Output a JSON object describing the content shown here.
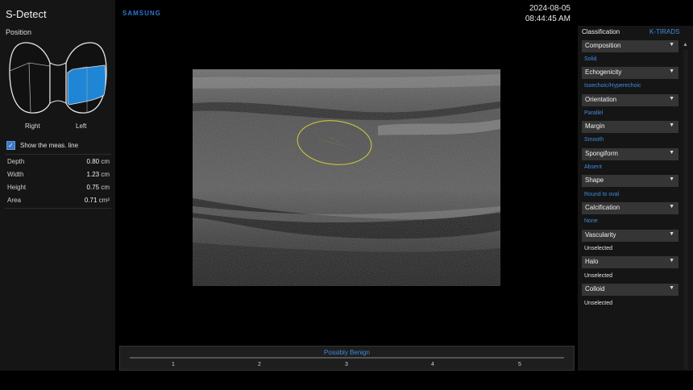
{
  "app": {
    "title": "S-Detect",
    "brand": "SAMSUNG"
  },
  "datetime": {
    "date": "2024-08-05",
    "time": "08:44:45 AM"
  },
  "position": {
    "label": "Position",
    "right": "Right",
    "left": "Left",
    "selected": "Left"
  },
  "measurement": {
    "show_line_label": "Show the meas. line",
    "show_line_checked": true,
    "rows": [
      {
        "label": "Depth",
        "value": "0.80",
        "unit": "cm"
      },
      {
        "label": "Width",
        "value": "1.23",
        "unit": "cm"
      },
      {
        "label": "Height",
        "value": "0.75",
        "unit": "cm"
      },
      {
        "label": "Area",
        "value": "0.71",
        "unit": "cm²"
      }
    ]
  },
  "classification": {
    "header": "Classification",
    "system": "K-TIRADS",
    "items": [
      {
        "name": "Composition",
        "value": "Solid",
        "state": "selected"
      },
      {
        "name": "Echogenicity",
        "value": "Isoechoic/Hyperechoic",
        "state": "selected"
      },
      {
        "name": "Orientation",
        "value": "Parallel",
        "state": "selected"
      },
      {
        "name": "Margin",
        "value": "Smooth",
        "state": "selected"
      },
      {
        "name": "Spongiform",
        "value": "Absent",
        "state": "selected"
      },
      {
        "name": "Shape",
        "value": "Round to oval",
        "state": "selected"
      },
      {
        "name": "Calcification",
        "value": "None",
        "state": "selected"
      },
      {
        "name": "Vascularity",
        "value": "Unselected",
        "state": "unselected"
      },
      {
        "name": "Halo",
        "value": "Unselected",
        "state": "unselected"
      },
      {
        "name": "Colloid",
        "value": "Unselected",
        "state": "unselected"
      }
    ]
  },
  "result": {
    "label": "Possibly Benign",
    "scale": [
      "1",
      "2",
      "3",
      "4",
      "5"
    ]
  },
  "colors": {
    "accent": "#3f8be0",
    "brand": "#2f74d0",
    "roi": "#c8c43a",
    "lobe_selected": "#1f86d6"
  },
  "icons": {
    "dropdown": "chevron-down-icon",
    "check": "check-icon",
    "scroll_up": "scroll-up-icon"
  }
}
